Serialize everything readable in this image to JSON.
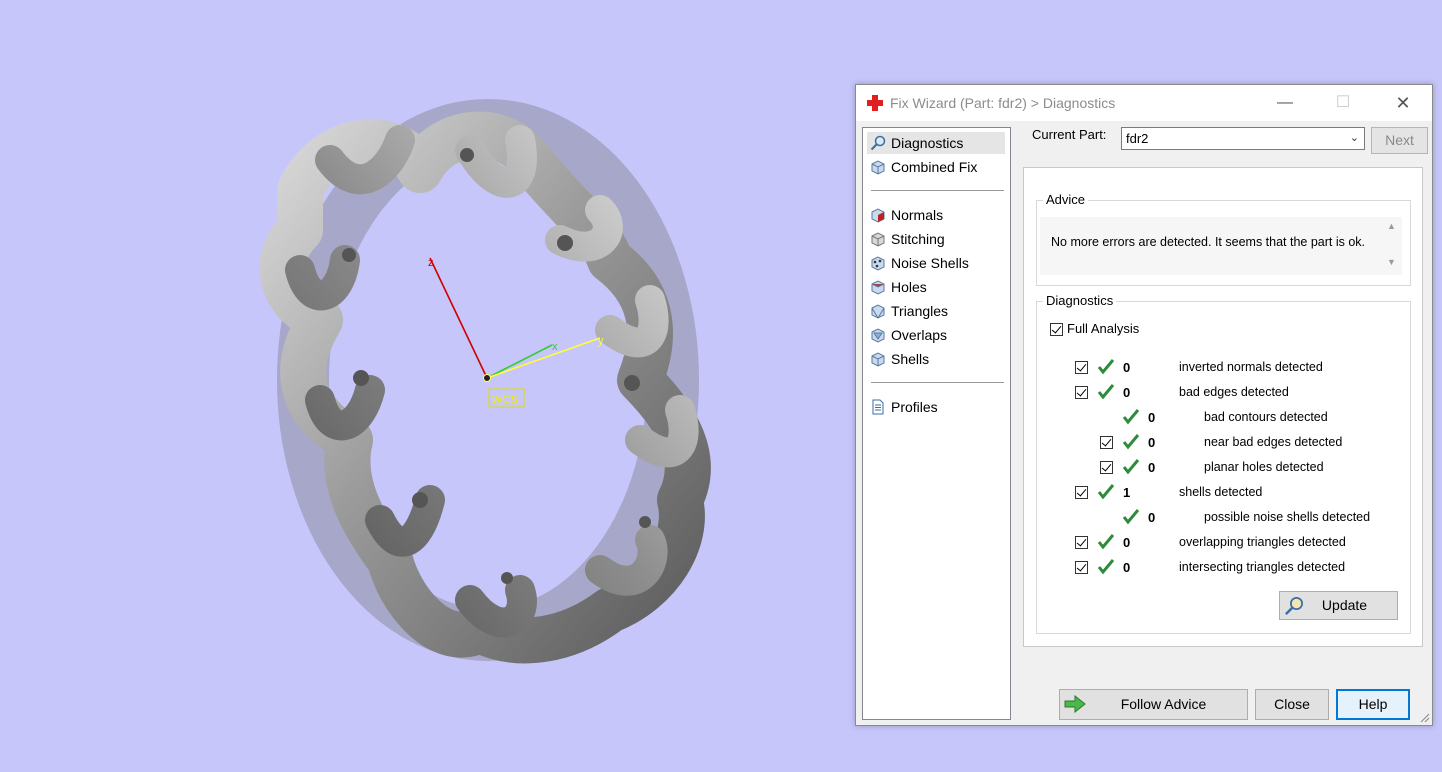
{
  "viewport": {
    "background": "#c6c6fb",
    "axes": {
      "z_label": "z",
      "x_label": "x",
      "y_label": "y",
      "origin_label": "WCS"
    }
  },
  "window": {
    "title": "Fix Wizard (Part: fdr2) > Diagnostics",
    "title_icon": "red-cross-icon",
    "controls": {
      "minimize": "—",
      "maximize": "☐",
      "close": "✕"
    }
  },
  "nav": {
    "items": [
      {
        "label": "Diagnostics",
        "icon": "magnifier-icon",
        "selected": true
      },
      {
        "label": "Combined Fix",
        "icon": "cube-icon"
      },
      {
        "label": "Normals",
        "icon": "normals-cube-icon"
      },
      {
        "label": "Stitching",
        "icon": "stitching-cube-icon"
      },
      {
        "label": "Noise Shells",
        "icon": "noise-shells-icon"
      },
      {
        "label": "Holes",
        "icon": "holes-cube-icon"
      },
      {
        "label": "Triangles",
        "icon": "triangles-icon"
      },
      {
        "label": "Overlaps",
        "icon": "overlaps-icon"
      },
      {
        "label": "Shells",
        "icon": "shells-icon"
      },
      {
        "label": "Profiles",
        "icon": "document-icon"
      }
    ]
  },
  "header": {
    "current_part_label": "Current Part:",
    "current_part_value": "fdr2",
    "next_label": "Next"
  },
  "advice": {
    "title": "Advice",
    "text": "No more errors are detected. It seems that the part is ok."
  },
  "diagnostics": {
    "title": "Diagnostics",
    "full_analysis_label": "Full Analysis",
    "full_analysis_checked": true,
    "rows": [
      {
        "checkbox": true,
        "value": "0",
        "label": "inverted normals detected",
        "indent": 0
      },
      {
        "checkbox": true,
        "value": "0",
        "label": "bad edges detected",
        "indent": 0
      },
      {
        "checkbox": false,
        "value": "0",
        "label": "bad contours detected",
        "indent": 1
      },
      {
        "checkbox": true,
        "value": "0",
        "label": "near bad edges detected",
        "indent": 1
      },
      {
        "checkbox": true,
        "value": "0",
        "label": "planar holes detected",
        "indent": 1
      },
      {
        "checkbox": true,
        "value": "1",
        "label": "shells detected",
        "indent": 0
      },
      {
        "checkbox": false,
        "value": "0",
        "label": "possible noise shells detected",
        "indent": 1
      },
      {
        "checkbox": true,
        "value": "0",
        "label": "overlapping triangles detected",
        "indent": 0
      },
      {
        "checkbox": true,
        "value": "0",
        "label": "intersecting triangles detected",
        "indent": 0
      }
    ],
    "update_label": "Update"
  },
  "footer": {
    "follow_advice_label": "Follow Advice",
    "close_label": "Close",
    "help_label": "Help"
  },
  "colors": {
    "check_green": "#2e8b3a",
    "accent_blue": "#0078d7",
    "title_red": "#e02020"
  }
}
